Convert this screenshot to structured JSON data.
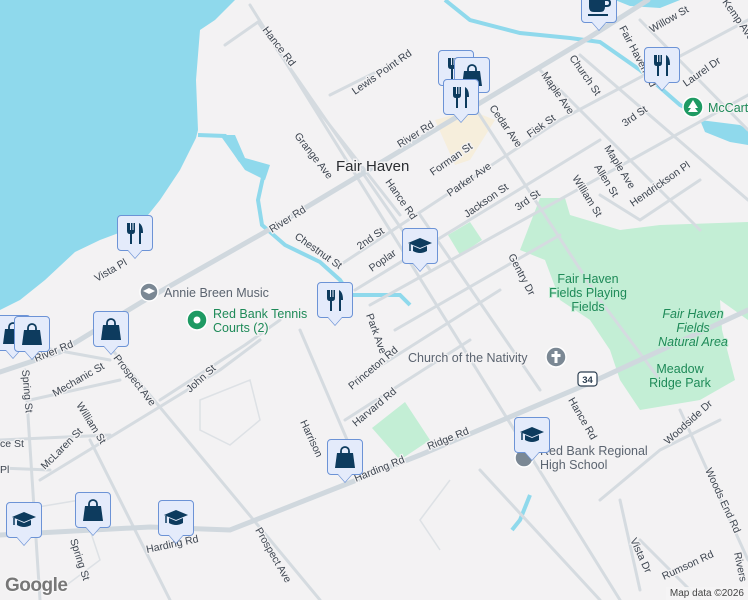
{
  "map": {
    "colors": {
      "water": "#8fd9ec",
      "park": "#c3eed5",
      "road": "#d5dbe0",
      "marker_bg": "#e4ebfb",
      "marker_border": "#6c93d6",
      "icon": "#0d3b5e"
    },
    "place": "Fair Haven",
    "streets": [
      "Hance Rd",
      "Lewis Point Rd",
      "River Rd",
      "Grange Ave",
      "Forman St",
      "Cedar Ave",
      "Fisk St",
      "Maple Ave",
      "Church St",
      "Parker Ave",
      "Hance Rd",
      "Jackson St",
      "3rd St",
      "William St",
      "Allen St",
      "Maple Ave",
      "Hendrickson Pl",
      "3rd St",
      "Laurel Dr",
      "Willow St",
      "Fair Haven Rd",
      "Kemp Ave",
      "River Rd",
      "Chestnut St",
      "2nd St",
      "Poplar",
      "Gentry Dr",
      "Vista Pl",
      "Park Ave",
      "Princeton Rd",
      "Harvard Rd",
      "Harrison",
      "River Rd",
      "Mechanic St",
      "Prospect Ave",
      "John St",
      "William St",
      "Spring St",
      "Spring St",
      "McLaren St",
      "ce St",
      "Pl",
      "Ridge Rd",
      "Harding Rd",
      "Harding Rd",
      "Prospect Ave",
      "Hance Rd",
      "Woodside Dr",
      "Woods End Rd",
      "Vista Dr",
      "Rumson Rd",
      "Rivers"
    ],
    "route_shield": "34",
    "pois": {
      "fields_playing": [
        "Fair Haven",
        "Fields Playing",
        "Fields"
      ],
      "fields_natural": [
        "Fair Haven",
        "Fields",
        "Natural Area"
      ],
      "meadow": [
        "Meadow",
        "Ridge Park"
      ],
      "mccarter": "McCarter",
      "annie": "Annie Breen Music",
      "tennis": [
        "Red Bank Tennis",
        "Courts (2)"
      ],
      "church": "Church of the Nativity",
      "school": [
        "Red Bank Regional",
        "High School"
      ]
    },
    "markers": [
      {
        "type": "restaurant"
      },
      {
        "type": "restaurant"
      },
      {
        "type": "education"
      },
      {
        "type": "restaurant"
      },
      {
        "type": "shopping"
      },
      {
        "type": "restaurant"
      },
      {
        "type": "coffee"
      },
      {
        "type": "restaurant"
      },
      {
        "type": "shopping"
      },
      {
        "type": "shopping"
      },
      {
        "type": "shopping"
      },
      {
        "type": "shopping"
      },
      {
        "type": "shopping"
      },
      {
        "type": "education"
      },
      {
        "type": "education"
      },
      {
        "type": "education"
      }
    ],
    "attribution": "Map data ©2026",
    "logo": "Google"
  }
}
